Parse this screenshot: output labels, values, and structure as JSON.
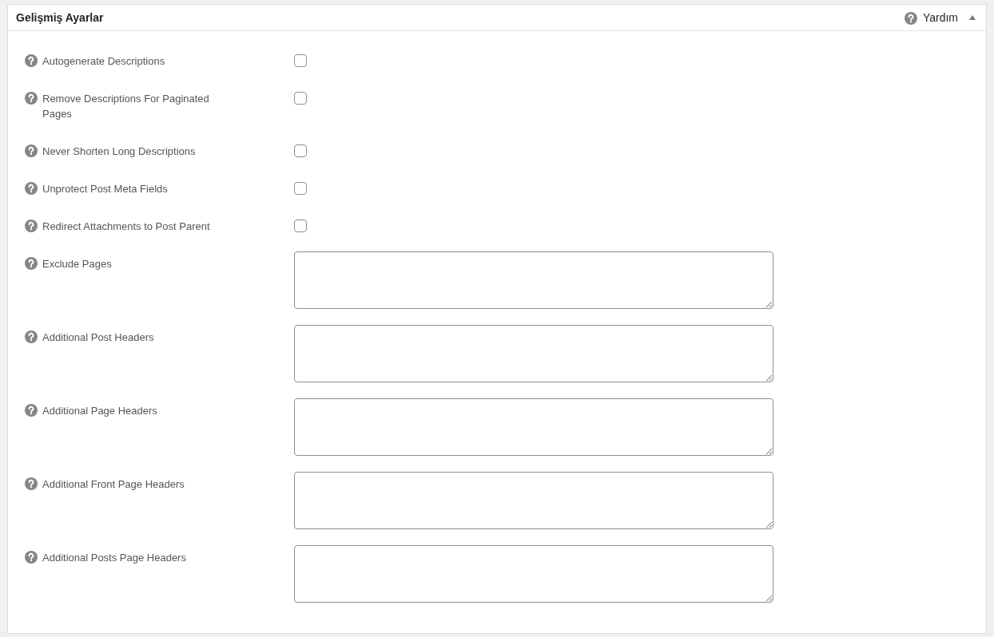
{
  "panel": {
    "title": "Gelişmiş Ayarlar",
    "help_label": "Yardım",
    "expanded": true
  },
  "settings": [
    {
      "kind": "checkbox",
      "label": "Autogenerate Descriptions",
      "checked": false
    },
    {
      "kind": "checkbox",
      "label": "Remove Descriptions For Paginated Pages",
      "checked": false
    },
    {
      "kind": "checkbox",
      "label": "Never Shorten Long Descriptions",
      "checked": false
    },
    {
      "kind": "checkbox",
      "label": "Unprotect Post Meta Fields",
      "checked": false
    },
    {
      "kind": "checkbox",
      "label": "Redirect Attachments to Post Parent",
      "checked": false
    },
    {
      "kind": "textarea",
      "label": "Exclude Pages"
    },
    {
      "kind": "textarea",
      "label": "Additional Post Headers"
    },
    {
      "kind": "textarea",
      "label": "Additional Page Headers"
    },
    {
      "kind": "textarea",
      "label": "Additional Front Page Headers"
    },
    {
      "kind": "textarea",
      "label": "Additional Posts Page Headers"
    }
  ]
}
